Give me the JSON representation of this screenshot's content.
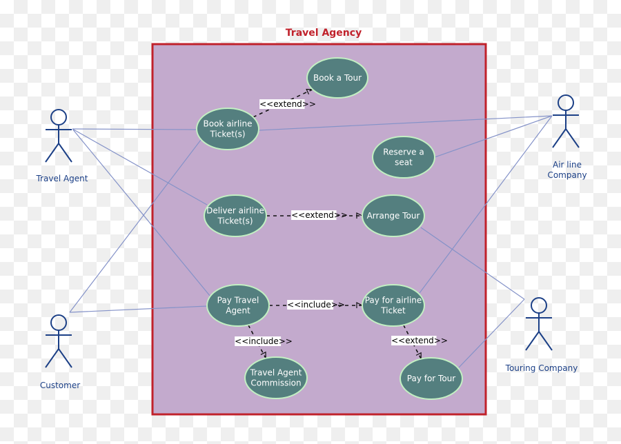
{
  "colors": {
    "system_fill": "#c3aacd",
    "system_border": "#c0212b",
    "usecase_fill": "#547f7f",
    "usecase_border": "#c3f0c3",
    "actor": "#1b3f86",
    "association": "#8492c8",
    "dependency": "#111111"
  },
  "system": {
    "title": "Travel Agency"
  },
  "actors": [
    {
      "id": "travel-agent",
      "label_lines": [
        "Travel Agent"
      ]
    },
    {
      "id": "customer",
      "label_lines": [
        "Customer"
      ]
    },
    {
      "id": "airline-company",
      "label_lines": [
        "Air line",
        "Company"
      ]
    },
    {
      "id": "touring-company",
      "label_lines": [
        "Touring Company"
      ]
    }
  ],
  "use_cases": [
    {
      "id": "book-a-tour",
      "label_lines": [
        "Book a Tour"
      ]
    },
    {
      "id": "book-airline-tickets",
      "label_lines": [
        "Book airline",
        "Ticket(s)"
      ]
    },
    {
      "id": "reserve-a-seat",
      "label_lines": [
        "Reserve a",
        "seat"
      ]
    },
    {
      "id": "deliver-airline-tickets",
      "label_lines": [
        "Deliver airline",
        "Ticket(s)"
      ]
    },
    {
      "id": "arrange-tour",
      "label_lines": [
        "Arrange Tour"
      ]
    },
    {
      "id": "pay-travel-agent",
      "label_lines": [
        "Pay Travel",
        "Agent"
      ]
    },
    {
      "id": "pay-for-airline-ticket",
      "label_lines": [
        "Pay for airline",
        "Ticket"
      ]
    },
    {
      "id": "travel-agent-commission",
      "label_lines": [
        "Travel Agent",
        "Commission"
      ]
    },
    {
      "id": "pay-for-tour",
      "label_lines": [
        "Pay for Tour"
      ]
    }
  ],
  "associations": [
    {
      "actor": "travel-agent",
      "use_case": "book-airline-tickets"
    },
    {
      "actor": "travel-agent",
      "use_case": "deliver-airline-tickets"
    },
    {
      "actor": "travel-agent",
      "use_case": "pay-travel-agent"
    },
    {
      "actor": "customer",
      "use_case": "book-airline-tickets"
    },
    {
      "actor": "customer",
      "use_case": "pay-travel-agent"
    },
    {
      "actor": "airline-company",
      "use_case": "book-airline-tickets"
    },
    {
      "actor": "airline-company",
      "use_case": "reserve-a-seat"
    },
    {
      "actor": "airline-company",
      "use_case": "pay-for-airline-ticket"
    },
    {
      "actor": "touring-company",
      "use_case": "arrange-tour"
    },
    {
      "actor": "touring-company",
      "use_case": "pay-for-tour"
    }
  ],
  "relationships": [
    {
      "from": "book-airline-tickets",
      "to": "book-a-tour",
      "stereotype": "<<extend>>"
    },
    {
      "from": "deliver-airline-tickets",
      "to": "arrange-tour",
      "stereotype": "<<extend>>"
    },
    {
      "from": "pay-travel-agent",
      "to": "pay-for-airline-ticket",
      "stereotype": "<<include>>"
    },
    {
      "from": "pay-travel-agent",
      "to": "travel-agent-commission",
      "stereotype": "<<include>>"
    },
    {
      "from": "pay-for-airline-ticket",
      "to": "pay-for-tour",
      "stereotype": "<<extend>>"
    }
  ]
}
